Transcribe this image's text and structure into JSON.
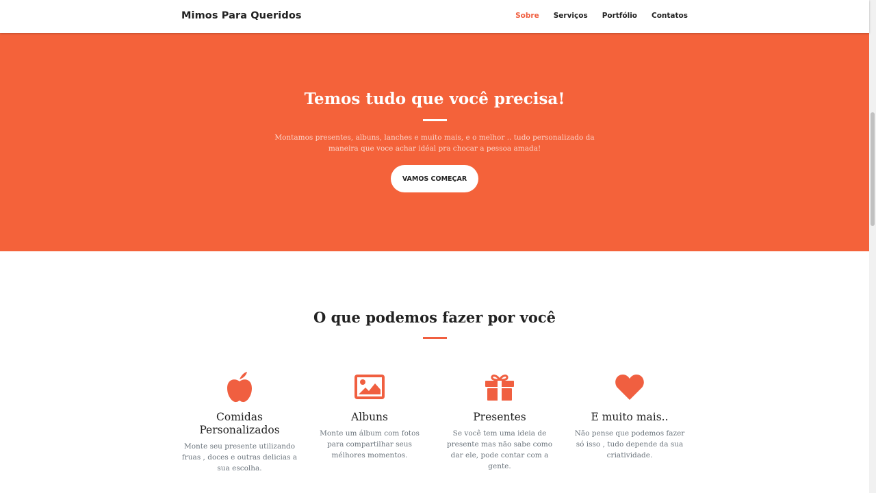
{
  "navbar": {
    "brand": "Mimos Para Queridos",
    "links": [
      {
        "label": "Sobre",
        "active": true
      },
      {
        "label": "Serviços",
        "active": false
      },
      {
        "label": "Portfólio",
        "active": false
      },
      {
        "label": "Contatos",
        "active": false
      }
    ]
  },
  "hero": {
    "title": "Temos tudo que você precisa!",
    "text": "Montamos presentes, albuns, lanches e muito mais, e o melhor .. tudo personalizado da maneira que voce achar idéal pra chocar a pessoa amada!",
    "button": "VAMOS COMEÇAR",
    "bg_color": "#F4623A"
  },
  "services": {
    "title": "O que podemos fazer por você",
    "items": [
      {
        "icon": "apple-icon",
        "title": "Comidas Personalizados",
        "text": "Monte seu presente utilizando fruas , doces e outras delicias a sua escolha."
      },
      {
        "icon": "image-icon",
        "title": "Albuns",
        "text": "Monte um álbum com fotos para compartilhar seus mélhores momentos."
      },
      {
        "icon": "gift-icon",
        "title": "Presentes",
        "text": "Se você tem uma ideia de presente mas não sabe como dar ele, pode contar com a gente."
      },
      {
        "icon": "heart-icon",
        "title": "E muito mais..",
        "text": "Não pense que podemos fazer só isso , tudo depende da sua criatividade."
      }
    ]
  },
  "colors": {
    "accent": "#F05F40"
  }
}
